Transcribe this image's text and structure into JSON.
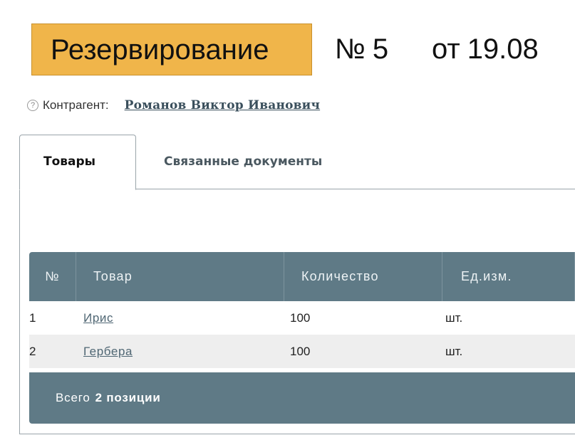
{
  "document": {
    "type": "Резервирование",
    "number_sign": "№",
    "number": "5",
    "date_prefix": "от",
    "date": "19.08"
  },
  "counterparty": {
    "help_icon": "?",
    "label": "Контрагент:",
    "name": "Романов Виктор Иванович"
  },
  "tabs": [
    {
      "label": "Товары",
      "active": true
    },
    {
      "label": "Связанные документы",
      "active": false
    }
  ],
  "table": {
    "columns": [
      "№",
      "Товар",
      "Количество",
      "Ед.изм."
    ],
    "rows": [
      {
        "num": "1",
        "item": "Ирис",
        "qty": "100",
        "unit": "шт."
      },
      {
        "num": "2",
        "item": "Гербера",
        "qty": "100",
        "unit": "шт."
      }
    ],
    "footer": {
      "label": "Всего",
      "value": "2 позиции"
    }
  },
  "colors": {
    "doc_type_bg": "#f0b54a",
    "table_header_bg": "#5f7a86",
    "alt_row_bg": "#eeeeee",
    "link": "#4f6673"
  }
}
